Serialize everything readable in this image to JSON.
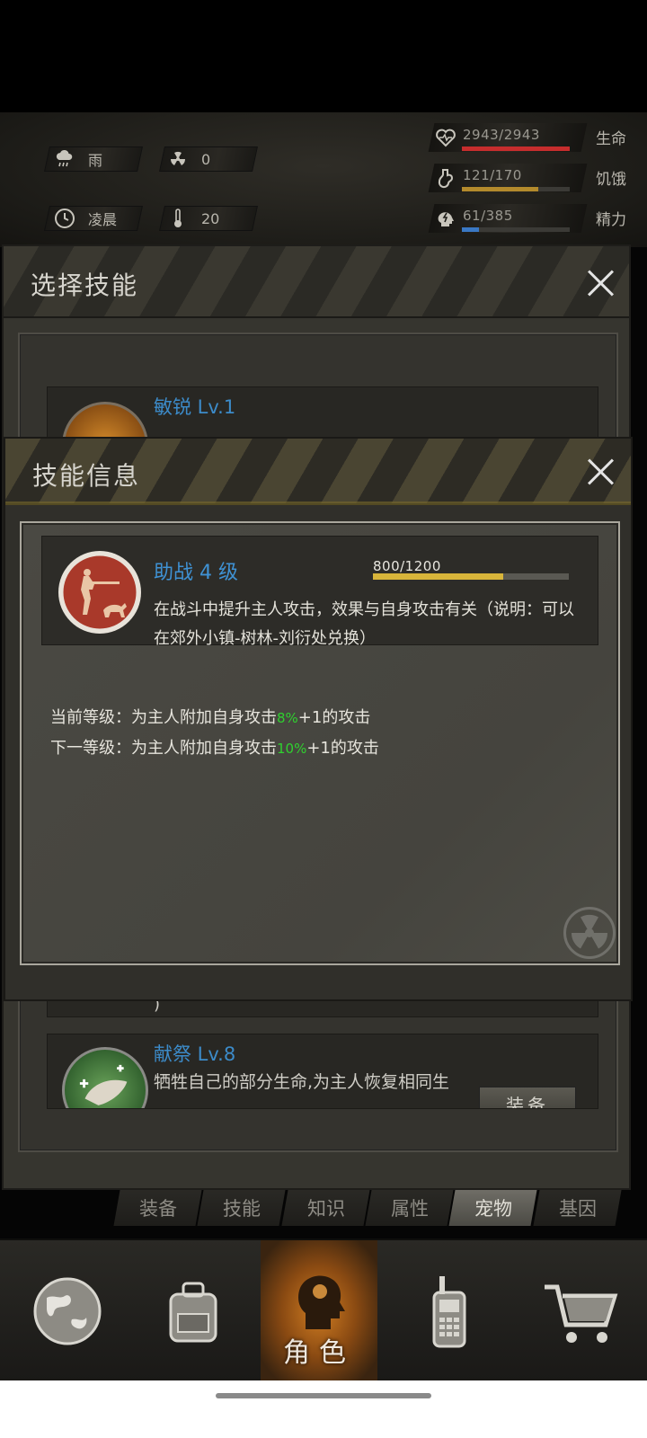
{
  "hud": {
    "weather": {
      "icon": "rain-cloud-icon",
      "label": "雨"
    },
    "radiation": {
      "icon": "radiation-icon",
      "value": "0"
    },
    "time": {
      "icon": "clock-icon",
      "label": "凌晨"
    },
    "temperature": {
      "icon": "thermometer-icon",
      "value": "20"
    },
    "stats": [
      {
        "icon": "heart-icon",
        "text": "2943/2943",
        "label": "生命",
        "fraction": 1.0,
        "color": "#c62d2d"
      },
      {
        "icon": "stomach-icon",
        "text": "121/170",
        "label": "饥饿",
        "fraction": 0.71,
        "color": "#b38a2c"
      },
      {
        "icon": "brain-icon",
        "text": "61/385",
        "label": "精力",
        "fraction": 0.16,
        "color": "#3a78c4"
      }
    ],
    "body_icon": "body-plus-minus-icon"
  },
  "select_panel": {
    "title": "选择技能",
    "skills": [
      {
        "name": "敏锐 Lv.1",
        "icon": "sharp-skill-icon"
      },
      {
        "name": "献祭 Lv.8",
        "desc": "牺牲自己的部分生命,为主人恢复相同生",
        "equip": "装备",
        "icon": "sacrifice-skill-icon"
      }
    ],
    "fragment_text": ")"
  },
  "modal": {
    "title": "技能信息",
    "skill": {
      "name": "助战 4 级",
      "progress_text": "800/1200",
      "progress": 0.667,
      "icon": "hunter-dog-icon",
      "desc": "在战斗中提升主人攻击，效果与自身攻击有关（说明：可以在郊外小镇-树林-刘衍处兑换）"
    },
    "current": {
      "prefix": "当前等级：为主人附加自身攻击",
      "pct": "8%",
      "suffix": "+1的攻击"
    },
    "next": {
      "prefix": "下一等级：为主人附加自身攻击",
      "pct": "10%",
      "suffix": "+1的攻击"
    }
  },
  "tabs": [
    "装备",
    "技能",
    "知识",
    "属性",
    "宠物",
    "基因"
  ],
  "active_tab": "宠物",
  "bottom_nav": [
    {
      "icon": "globe-icon"
    },
    {
      "icon": "backpack-icon"
    },
    {
      "icon": "head-profile-icon",
      "label": "角色",
      "active": true
    },
    {
      "icon": "walkie-talkie-icon"
    },
    {
      "icon": "shopping-cart-icon"
    }
  ]
}
